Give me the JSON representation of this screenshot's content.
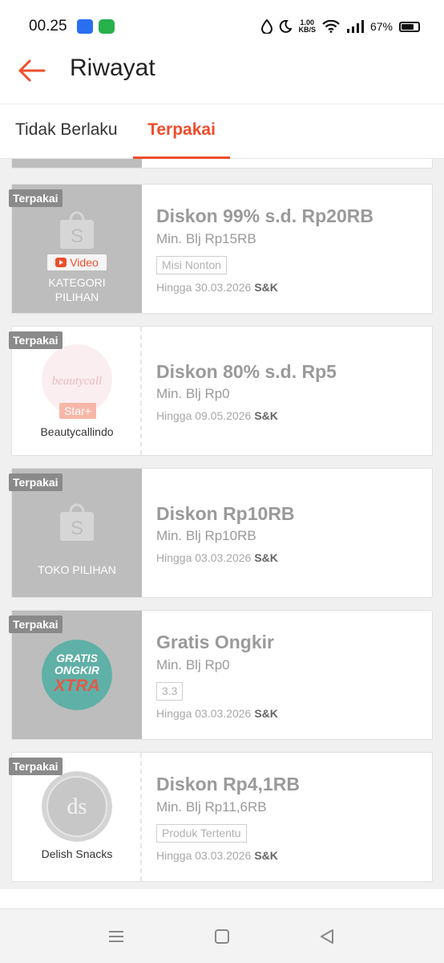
{
  "status_bar": {
    "time": "00.25",
    "network_speed_value": "1.00",
    "network_speed_unit": "KB/S",
    "battery": "67%"
  },
  "header": {
    "title": "Riwayat",
    "back_icon": "arrow-left-icon"
  },
  "tabs": [
    {
      "label": "Tidak Berlaku",
      "active": false
    },
    {
      "label": "Terpakai",
      "active": true
    }
  ],
  "colors": {
    "accent": "#ee4d2d",
    "muted_text": "#9a9a9a",
    "badge_bg": "#8a8a8a"
  },
  "vouchers": [
    {
      "badge": "Terpakai",
      "left_label_line1": "KATEGORI",
      "left_label_line2": "PILIHAN",
      "video_tag": "Video",
      "title": "Diskon 99% s.d. Rp20RB",
      "min_spend": "Min. Blj Rp15RB",
      "tag": "Misi Nonton",
      "valid_until": "Hingga 30.03.2026",
      "terms": "S&K"
    },
    {
      "badge": "Terpakai",
      "store_name": "Beautycallindo",
      "logo_text": "beautycall",
      "store_tier": "Star+",
      "title": "Diskon 80% s.d. Rp5",
      "min_spend": "Min. Blj Rp0",
      "valid_until": "Hingga 09.05.2026",
      "terms": "S&K"
    },
    {
      "badge": "Terpakai",
      "left_label_line1": "TOKO PILIHAN",
      "title": "Diskon Rp10RB",
      "min_spend": "Min. Blj Rp10RB",
      "valid_until": "Hingga 03.03.2026",
      "terms": "S&K"
    },
    {
      "badge": "Terpakai",
      "logo_line1": "GRATIS",
      "logo_line2": "ONGKIR",
      "logo_line3": "XTRA",
      "title": "Gratis Ongkir",
      "min_spend": "Min. Blj Rp0",
      "tag": "3.3",
      "valid_until": "Hingga 03.03.2026",
      "terms": "S&K"
    },
    {
      "badge": "Terpakai",
      "store_name": "Delish Snacks",
      "logo_text": "ds",
      "title": "Diskon Rp4,1RB",
      "min_spend": "Min. Blj Rp11,6RB",
      "tag": "Produk Tertentu",
      "valid_until": "Hingga 03.03.2026",
      "terms": "S&K"
    }
  ],
  "nav_bar": {
    "buttons": [
      "menu-icon",
      "home-square-icon",
      "back-triangle-icon"
    ]
  }
}
